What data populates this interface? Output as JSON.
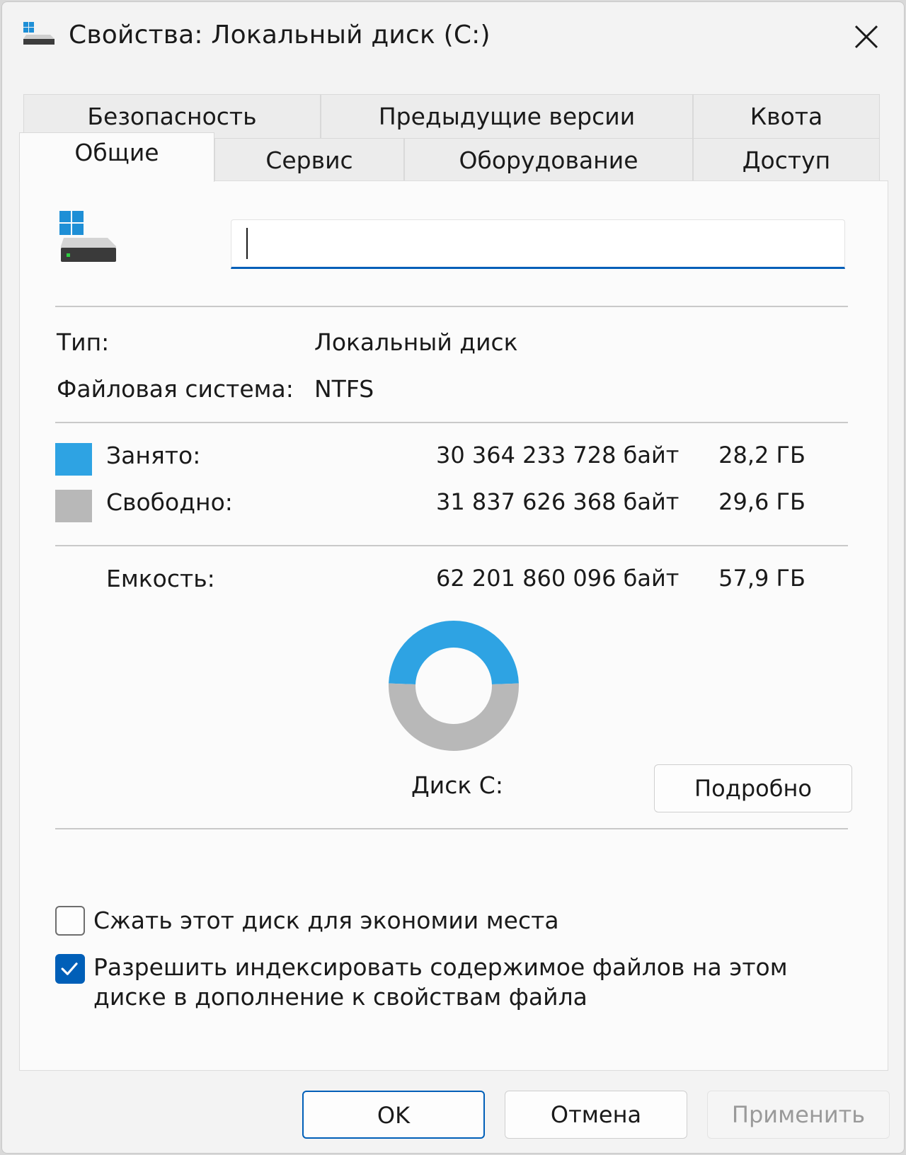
{
  "window": {
    "title": "Свойства: Локальный диск (C:)",
    "close_icon": "close-icon"
  },
  "tabs_row1": [
    {
      "label": "Безопасность"
    },
    {
      "label": "Предыдущие версии"
    },
    {
      "label": "Квота"
    }
  ],
  "tabs_row2": [
    {
      "label": "Общие",
      "active": true
    },
    {
      "label": "Сервис"
    },
    {
      "label": "Оборудование"
    },
    {
      "label": "Доступ"
    }
  ],
  "general": {
    "drive_icon": "drive-icon",
    "name_value": "",
    "type_label": "Тип:",
    "type_value": "Локальный диск",
    "fs_label": "Файловая система:",
    "fs_value": "NTFS",
    "used": {
      "label": "Занято:",
      "bytes": "30 364 233 728 байт",
      "gb": "28,2 ГБ",
      "color": "#2ea3e3"
    },
    "free": {
      "label": "Свободно:",
      "bytes": "31 837 626 368 байт",
      "gb": "29,6 ГБ",
      "color": "#b8b8b8"
    },
    "capacity": {
      "label": "Емкость:",
      "bytes": "62 201 860 096 байт",
      "gb": "57,9 ГБ"
    },
    "disk_label": "Диск C:",
    "details_button": "Подробно",
    "compress_label": "Сжать этот диск для экономии места",
    "compress_checked": false,
    "index_label_line1": "Разрешить индексировать содержимое файлов на этом",
    "index_label_line2": "диске в дополнение к свойствам файла",
    "index_checked": true
  },
  "footer": {
    "ok": "OK",
    "cancel": "Отмена",
    "apply": "Применить"
  },
  "chart_data": {
    "type": "pie",
    "categories": [
      "Занято",
      "Свободно"
    ],
    "values": [
      30364233728,
      31837626368
    ],
    "colors": [
      "#2ea3e3",
      "#b8b8b8"
    ]
  }
}
